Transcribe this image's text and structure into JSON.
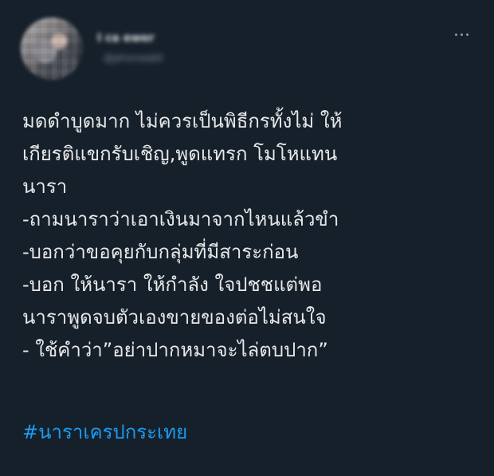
{
  "tweet": {
    "author_name": "I ca ewer",
    "author_handle": "@phoneabt",
    "body_lines": [
      "มดดำบูดมาก ไม่ควรเป็นพิธีกรทั้งไม่ ให้",
      "เกียรติแขกรับเชิญ,พูดแทรก โมโหแทน",
      "นารา",
      "-ถามนาราว่าเอาเงินมาจากไหนแล้วขำ",
      "-บอกว่าขอคุยกับกลุ่มที่มีสาระก่อน",
      "-บอก ให้นารา ให้กำลัง ใจปชชแต่พอ",
      "นาราพูดจบตัวเองขายของต่อไม่สนใจ",
      "- ใช้คำว่า”อย่าปากหมาจะไล่ตบปาก”"
    ],
    "hashtag": "#นาราเครปกระเทย",
    "more_icon": "ellipsis-icon"
  },
  "colors": {
    "background": "#15202b",
    "text": "#e8e8e8",
    "hashtag": "#1d9bf0",
    "muted": "#8899a6"
  }
}
